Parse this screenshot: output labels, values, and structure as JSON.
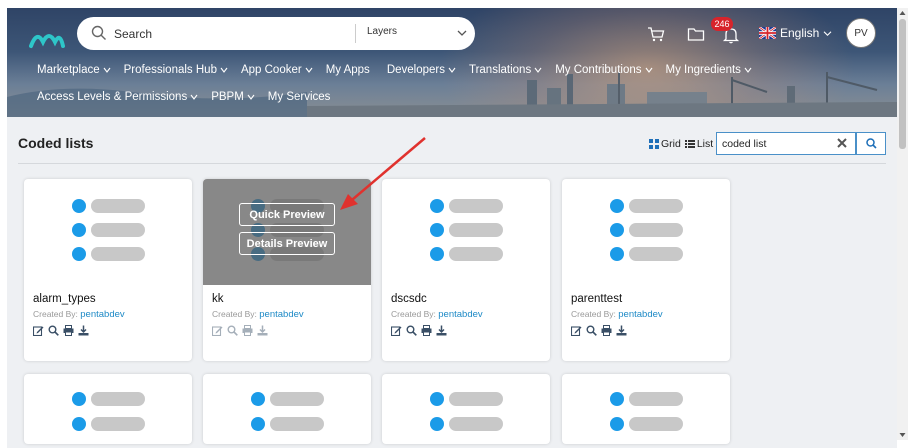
{
  "header": {
    "search_placeholder": "Search",
    "layers_label": "Layers",
    "notification_count": "246",
    "language": "English",
    "avatar_initials": "PV"
  },
  "nav": {
    "row1": [
      {
        "label": "Marketplace",
        "dropdown": true
      },
      {
        "label": "Professionals Hub",
        "dropdown": true
      },
      {
        "label": "App Cooker",
        "dropdown": true
      },
      {
        "label": "My Apps",
        "dropdown": false
      },
      {
        "label": "Developers",
        "dropdown": true
      },
      {
        "label": "Translations",
        "dropdown": true
      },
      {
        "label": "My Contributions",
        "dropdown": true
      },
      {
        "label": "My Ingredients",
        "dropdown": true
      }
    ],
    "row2": [
      {
        "label": "Access Levels & Permissions",
        "dropdown": true
      },
      {
        "label": "PBPM",
        "dropdown": true
      },
      {
        "label": "My Services",
        "dropdown": false
      }
    ]
  },
  "page": {
    "title": "Coded lists",
    "grid_label": "Grid",
    "list_label": "List",
    "filter_value": "coded list"
  },
  "cards": [
    {
      "name": "alarm_types",
      "created_by_label": "Created By:",
      "author": "pentabdev"
    },
    {
      "name": "kk",
      "created_by_label": "Created By:",
      "author": "pentabdev"
    },
    {
      "name": "dscsdc",
      "created_by_label": "Created By:",
      "author": "pentabdev"
    },
    {
      "name": "parenttest",
      "created_by_label": "Created By:",
      "author": "pentabdev"
    }
  ],
  "overlay": {
    "quick_preview": "Quick Preview",
    "details_preview": "Details Preview"
  },
  "colors": {
    "accent_blue": "#1b9be8",
    "link_blue": "#1e8ac6",
    "badge_red": "#d7242b",
    "arrow_red": "#e0322e"
  }
}
